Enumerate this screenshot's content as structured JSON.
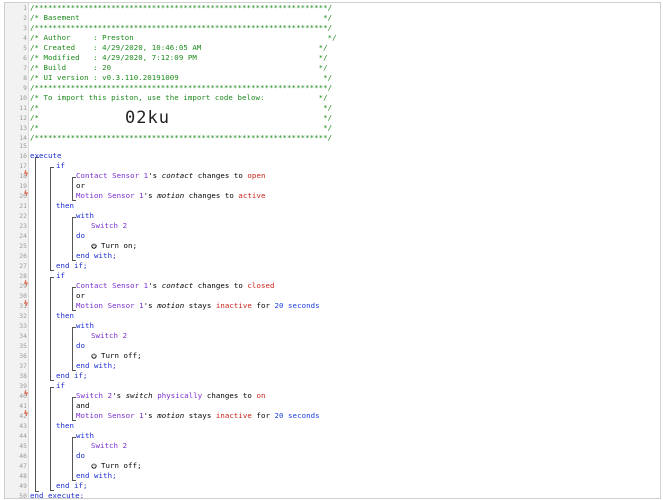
{
  "line_numbers": [
    "1",
    "2",
    "3",
    "4",
    "5",
    "6",
    "7",
    "8",
    "9",
    "10",
    "11",
    "12",
    "13",
    "14",
    "15",
    "16",
    "17",
    "18",
    "19",
    "20",
    "21",
    "22",
    "23",
    "24",
    "25",
    "26",
    "27",
    "28",
    "29",
    "30",
    "31",
    "32",
    "33",
    "34",
    "35",
    "36",
    "37",
    "38",
    "39",
    "40",
    "41",
    "42",
    "43",
    "44",
    "45",
    "46",
    "47",
    "48",
    "49",
    "50"
  ],
  "header": {
    "border": "/*****************************************************************/",
    "title": "/* Basement                                                      */",
    "author": "/* Author     : Preston                                           */",
    "created": "/* Created    : 4/29/2020, 10:46:05 AM                          */",
    "modified": "/* Modified   : 4/29/2020, 7:12:09 PM                           */",
    "build": "/* Build      : 20                                              */",
    "ui_version": "/* UI version : v0.3.110.20191009                                */",
    "import_note": "/* To import this piston, use the import code below:            */",
    "blank": "/*                                                               */",
    "import_code": "02ku"
  },
  "code": {
    "execute": "execute",
    "end_execute": "end execute;",
    "if": "if",
    "or": "or",
    "and": "and",
    "then": "then",
    "with": "with",
    "do": "do",
    "end_with": "end with;",
    "end_if": "end if;",
    "possessive": "'s",
    "changes_to": "changes to",
    "stays": "stays",
    "for": "for",
    "seconds": "seconds",
    "turn_on": "Turn on;",
    "turn_off": "Turn off;",
    "contact_sensor": "Contact Sensor 1",
    "motion_sensor": "Motion Sensor 1",
    "switch": "Switch 2",
    "attr_contact": "contact",
    "attr_motion": "motion",
    "attr_switch": "switch",
    "val_open": "open",
    "val_active": "active",
    "val_closed": "closed",
    "val_inactive": "inactive",
    "val_on": "on",
    "physically": "physically",
    "duration": "20"
  },
  "trigger_marker": "ϟ",
  "colors": {
    "comment": "#1c8a1c",
    "keyword": "#1a2bd0",
    "device": "#7a2fd0",
    "value": "#c8221a",
    "number": "#1a3ee0",
    "trigger": "#e05a3c"
  },
  "icons": [
    "power-on-icon",
    "power-off-icon"
  ]
}
